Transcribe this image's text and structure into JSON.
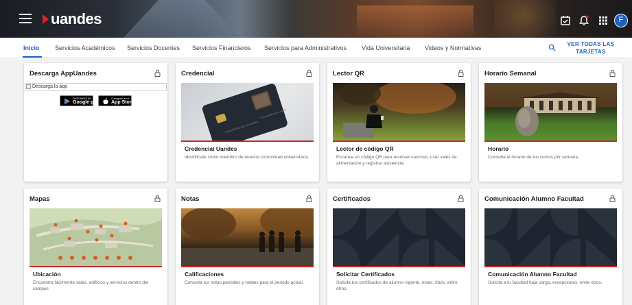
{
  "header": {
    "logo_text": "uandes",
    "avatar_letter": "F",
    "icons": [
      "menu-icon",
      "calendar-check-icon",
      "bell-icon",
      "grid-apps-icon"
    ],
    "notification_dot_color": "#e4202c"
  },
  "nav": {
    "tabs": [
      {
        "label": "Inicio",
        "active": true
      },
      {
        "label": "Servicios Académicos"
      },
      {
        "label": "Servicios Docentes"
      },
      {
        "label": "Servicios Financieros"
      },
      {
        "label": "Servicios para Administrativos"
      },
      {
        "label": "Vida Universitaria"
      },
      {
        "label": "Videos y Normativas"
      }
    ],
    "ver_todas": "VER TODAS LAS TARJETAS",
    "accent_color": "#1b62c6"
  },
  "cards": [
    {
      "title": "Descarga AppUandes",
      "broken_image_alt": "Descarga la app",
      "google_play_small": "DISPONIBLE EN",
      "google_play_big": "Google play",
      "app_store_small": "Consíguelo en el",
      "app_store_big": "App Store"
    },
    {
      "title": "Credencial",
      "subtitle": "Credencial Uandes",
      "description": "Identifícate como miembro de nuestra comunidad universitaria.",
      "card_name": "UNIVERSIDAD DE LOS ANDES",
      "card_subtext": "Universidad de los Andes"
    },
    {
      "title": "Lector QR",
      "subtitle": "Lector de código QR",
      "description": "Escanea un código QR para reservar canchas, usar vales de alimentación y registrar asistencia."
    },
    {
      "title": "Horario Semanal",
      "subtitle": "Horario",
      "description": "Consulta el horario de tus cursos por semana."
    },
    {
      "title": "Mapas",
      "subtitle": "Ubicación",
      "description": "Encuentra fácilmente salas, edificios y servicios dentro del campus"
    },
    {
      "title": "Notas",
      "subtitle": "Calificaciones",
      "description": "Consulta tus notas parciales y totales para el periodo actual."
    },
    {
      "title": "Certificados",
      "subtitle": "Solicitar Certificados",
      "description": "Solicita tus certificados de alumno vigente, notas, título, entre otros."
    },
    {
      "title": "Comunicación Alumno Facultad",
      "subtitle": "Comunicación Alumno Facultad",
      "description": "Solicita a tu facultad baja carga, excepciones, entre otros."
    }
  ]
}
